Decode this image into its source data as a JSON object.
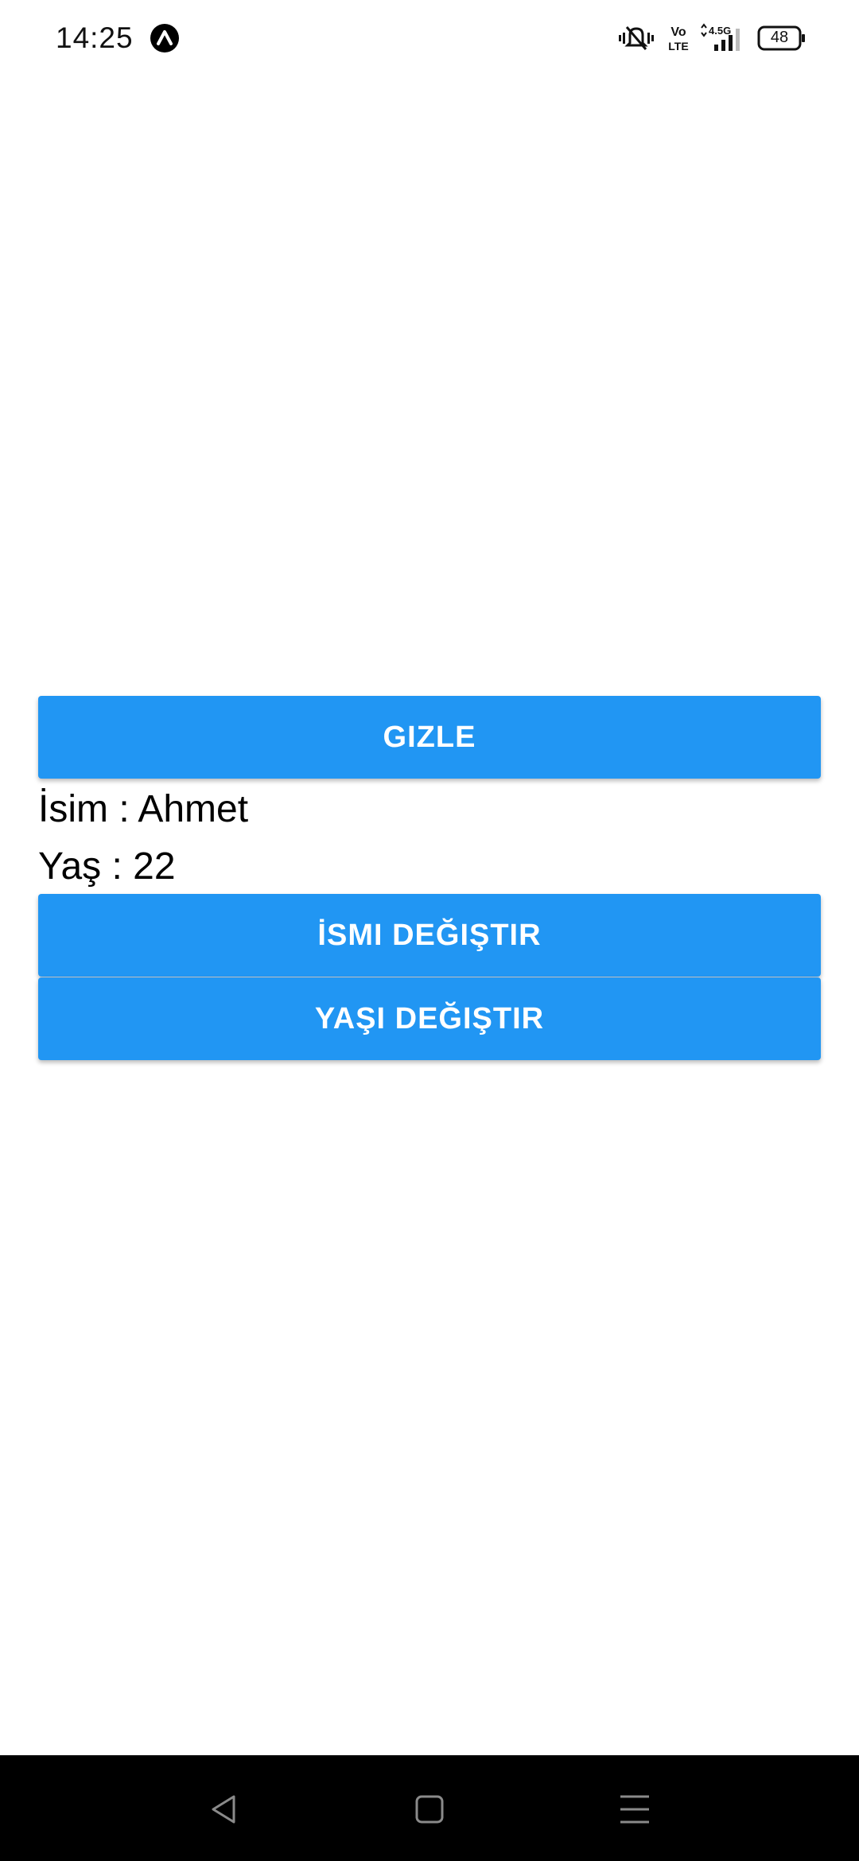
{
  "status_bar": {
    "time": "14:25",
    "battery_level": "48",
    "network": "4.5G",
    "volte": "Vo LTE",
    "icons": [
      "expo-icon",
      "vibrate-icon",
      "volte-icon",
      "signal-icon",
      "battery-icon"
    ]
  },
  "main": {
    "hide_button_label": "GIZLE",
    "name_label": "İsim : Ahmet",
    "age_label": "Yaş : 22",
    "change_name_button_label": "İSMI DEĞIŞTIR",
    "change_age_button_label": "YAŞI DEĞIŞTIR"
  },
  "colors": {
    "button_background": "#2196f3",
    "button_text": "#ffffff",
    "nav_bar_background": "#000000"
  },
  "nav_bar": {
    "icons": [
      "back-icon",
      "home-icon",
      "menu-icon"
    ]
  }
}
